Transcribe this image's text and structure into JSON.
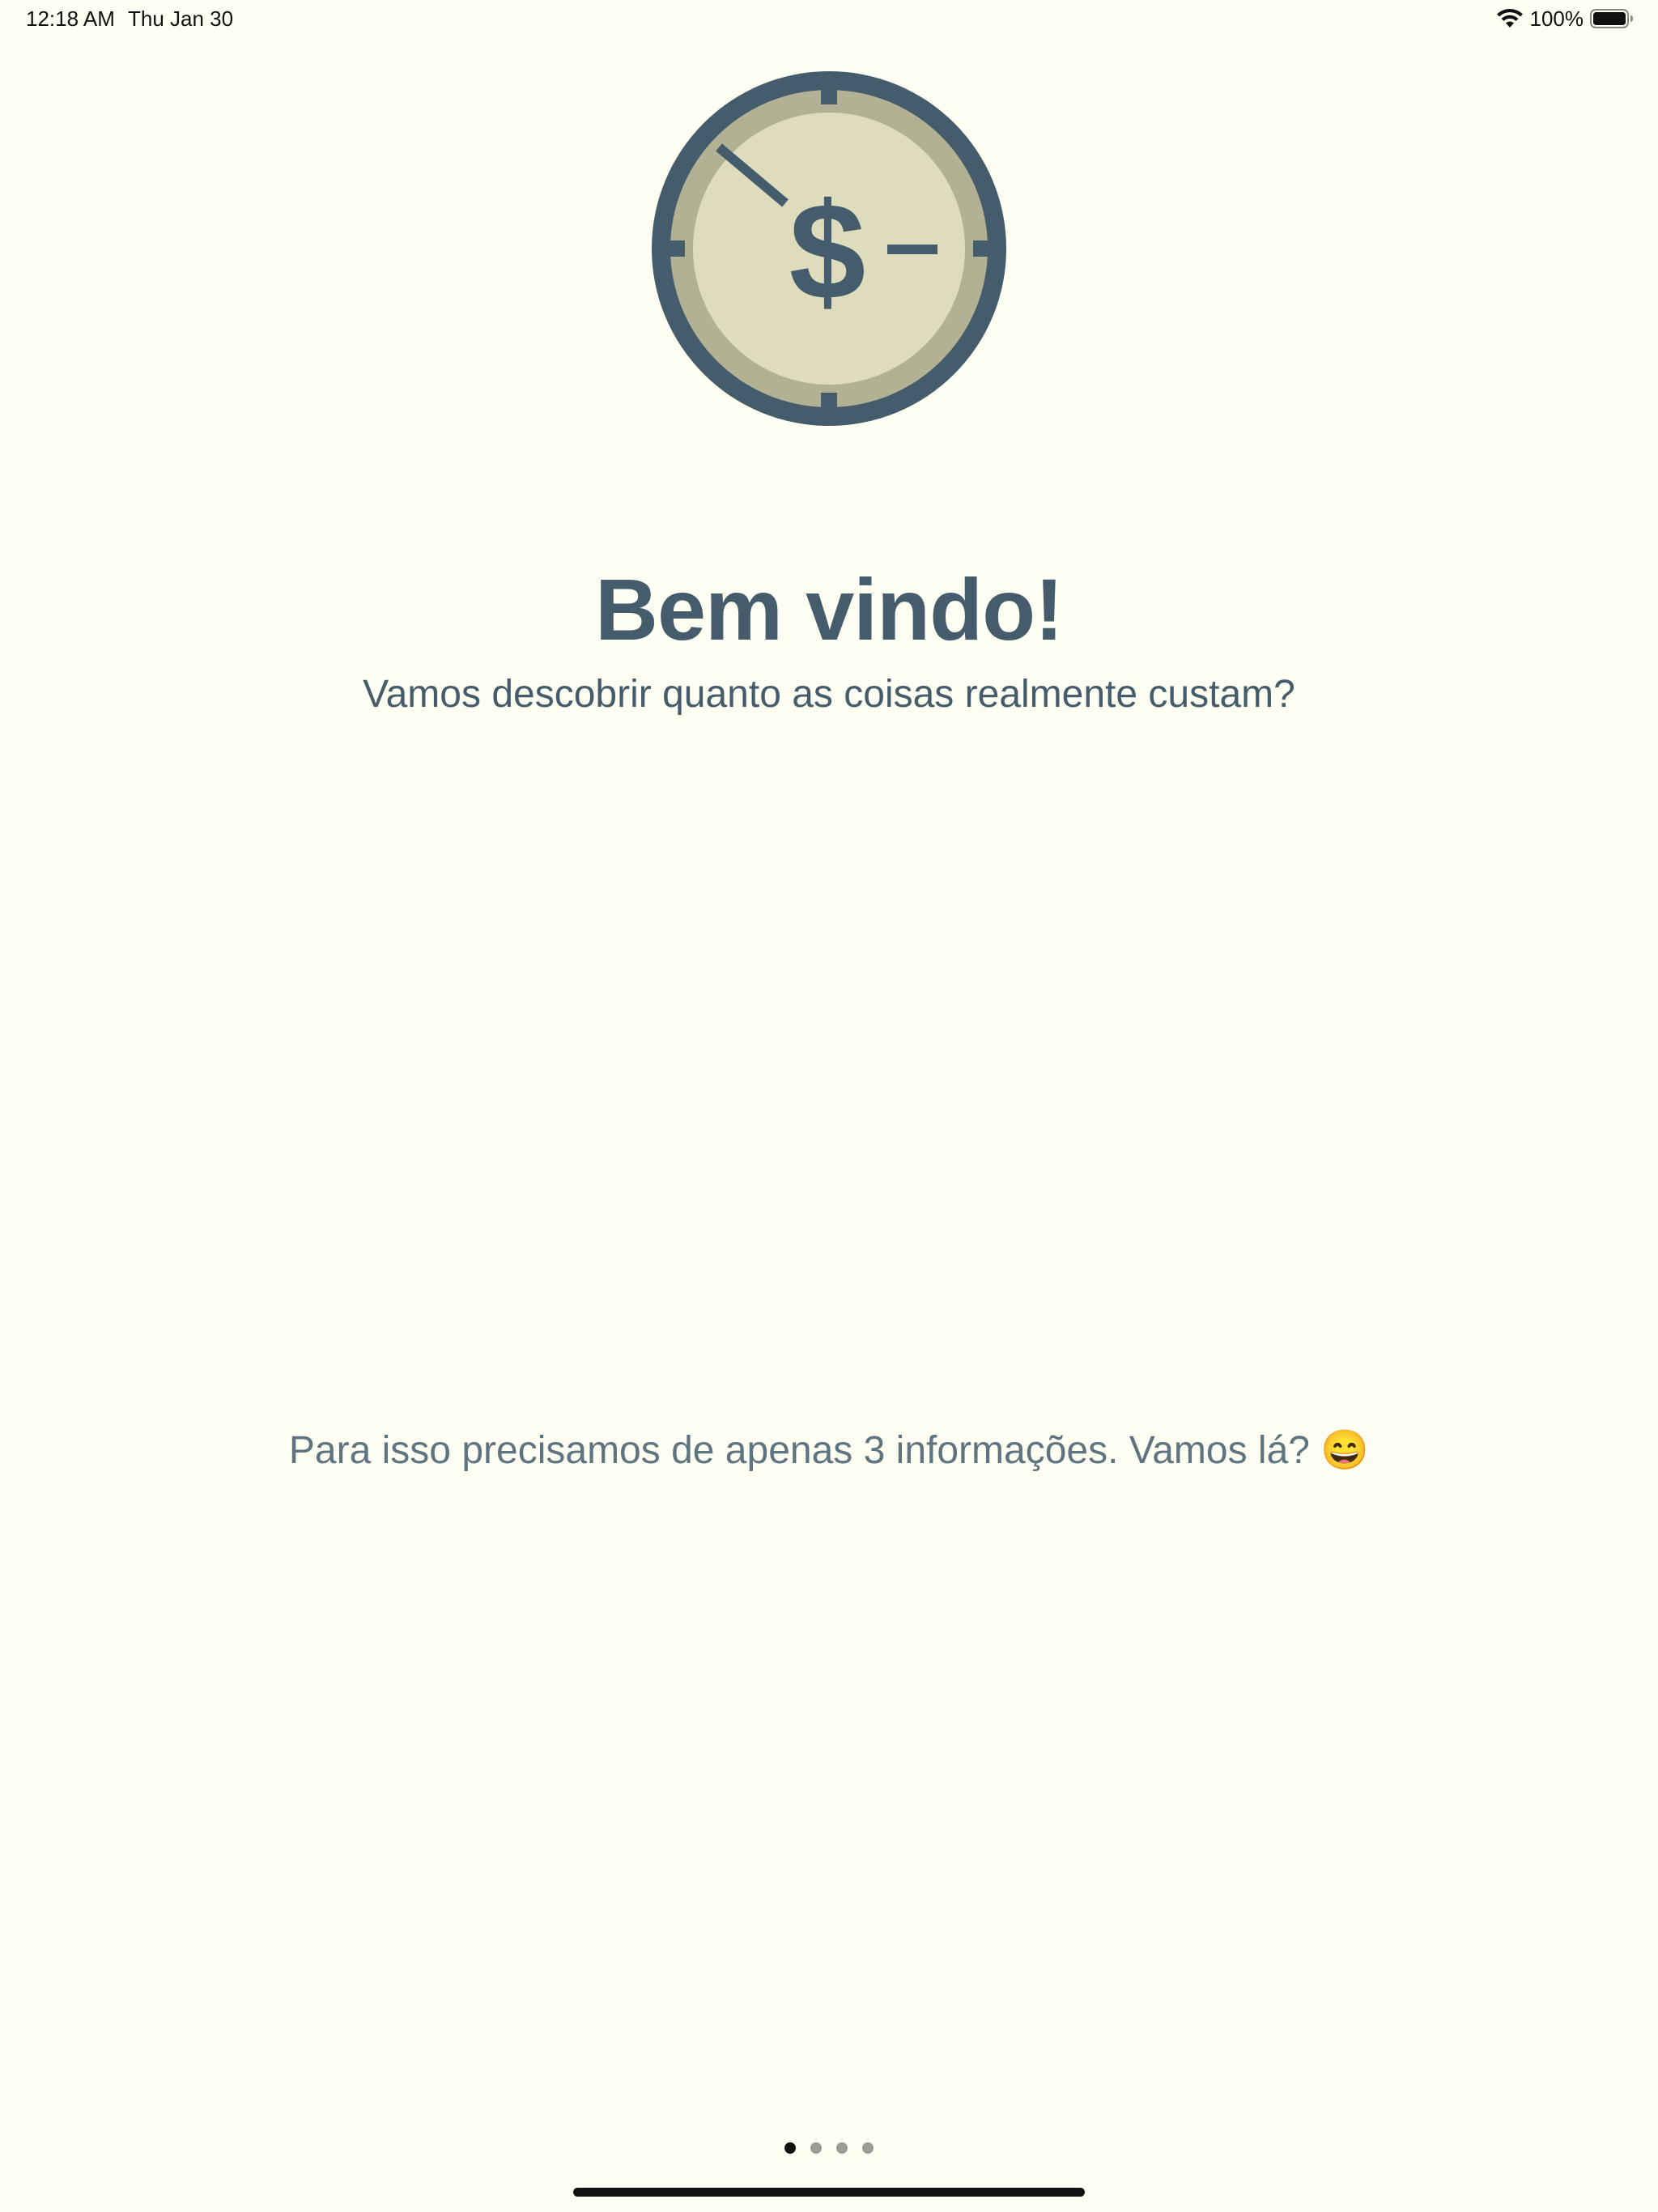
{
  "status_bar": {
    "time": "12:18 AM",
    "date": "Thu Jan 30",
    "battery_percent": "100%",
    "icons": [
      "wifi-icon",
      "battery-icon"
    ]
  },
  "logo": {
    "icon": "dollar-clock-icon",
    "symbol": "$",
    "colors": {
      "ring": "#445c6b",
      "inner_ring": "#b3b193",
      "face": "#dedcbc"
    }
  },
  "welcome": {
    "title": "Bem vindo!",
    "subtitle": "Vamos descobrir quanto as coisas realmente custam?"
  },
  "info": {
    "text": "Para isso precisamos de apenas 3 informações. Vamos lá? 😄"
  },
  "page_indicator": {
    "total": 4,
    "current": 1
  },
  "colors": {
    "background": "#fffef2",
    "primary_text": "#445c6b",
    "active_dot": "#111111",
    "inactive_dot": "#9b9b98"
  }
}
